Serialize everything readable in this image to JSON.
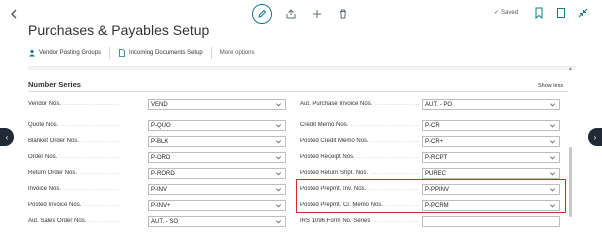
{
  "header": {
    "title": "Purchases & Payables Setup",
    "saved_label": "Saved"
  },
  "actions": [
    {
      "label": "Vendor Posting Groups",
      "icon": "vendor-icon"
    },
    {
      "label": "Incoming Documents Setup",
      "icon": "document-icon"
    },
    {
      "label": "More options",
      "icon": ""
    }
  ],
  "section": {
    "title": "Number Series",
    "toggle_label": "Show less"
  },
  "left_fields": [
    {
      "label": "Vendor Nos.",
      "value": "VEND"
    },
    {
      "label": "Quote Nos.",
      "value": "P-QUO"
    },
    {
      "label": "Blanket Order Nos.",
      "value": "P-BLK"
    },
    {
      "label": "Order Nos.",
      "value": "P-ORD"
    },
    {
      "label": "Return Order Nos.",
      "value": "P-RORD"
    },
    {
      "label": "Invoice Nos.",
      "value": "P-INV"
    },
    {
      "label": "Posted Invoice Nos.",
      "value": "P-INV+"
    },
    {
      "label": "Aut. Sales Order Nos.",
      "value": "AUT. - SO"
    }
  ],
  "right_fields": [
    {
      "label": "Aut. Purchase Invoice Nos.",
      "value": "AUT. - PO"
    },
    {
      "label": "Credit Memo Nos.",
      "value": "P-CR"
    },
    {
      "label": "Posted Credit Memo Nos.",
      "value": "P-CR+"
    },
    {
      "label": "Posted Receipt Nos.",
      "value": "P-RCPT"
    },
    {
      "label": "Posted Return Shpt. Nos.",
      "value": "PUREC"
    },
    {
      "label": "Posted Prepmt. Inv. Nos.",
      "value": "P-PPINV"
    },
    {
      "label": "Posted Prepmt. Cr. Memo Nos.",
      "value": "P-PCRM"
    },
    {
      "label": "IRS 1096 Form No. Series",
      "value": ""
    }
  ],
  "colors": {
    "accent": "#0f7b86",
    "highlight": "#d62a2a",
    "nav_bg": "#1f2a36"
  }
}
